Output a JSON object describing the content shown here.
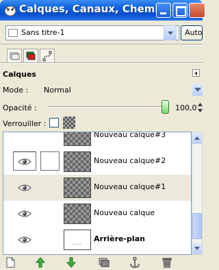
{
  "window": {
    "title": "Calques, Canaux, Chemins",
    "brand_color": "#0a5fd8"
  },
  "image_selector": {
    "value": "Sans titre-1",
    "auto_label": "Auto"
  },
  "tabs": [
    {
      "name": "layers-tab",
      "icon": "layers-icon"
    },
    {
      "name": "channels-tab",
      "icon": "channels-icon"
    },
    {
      "name": "paths-tab",
      "icon": "paths-icon"
    }
  ],
  "panel": {
    "title": "Calques",
    "mode_label": "Mode :",
    "mode_value": "Normal",
    "opacity_label": "Opacité :",
    "opacity_value": "100,0",
    "opacity_fraction": 1.0,
    "lock_label": "Verrouiller :"
  },
  "layers": [
    {
      "name": "Nouveau calque#3",
      "visible": false,
      "transparent": true,
      "active": false,
      "bold": false
    },
    {
      "name": "Nouveau calque#2",
      "visible": true,
      "transparent": true,
      "active": false,
      "bold": false,
      "focused": true
    },
    {
      "name": "Nouveau calque#1",
      "visible": true,
      "transparent": true,
      "active": true,
      "bold": false
    },
    {
      "name": "Nouveau calque",
      "visible": true,
      "transparent": true,
      "active": false,
      "bold": false
    },
    {
      "name": "Arrière-plan",
      "visible": true,
      "transparent": false,
      "active": false,
      "bold": true
    }
  ],
  "toolbar": [
    "new-layer-icon",
    "raise-layer-icon",
    "lower-layer-icon",
    "duplicate-layer-icon",
    "anchor-layer-icon",
    "delete-layer-icon"
  ]
}
